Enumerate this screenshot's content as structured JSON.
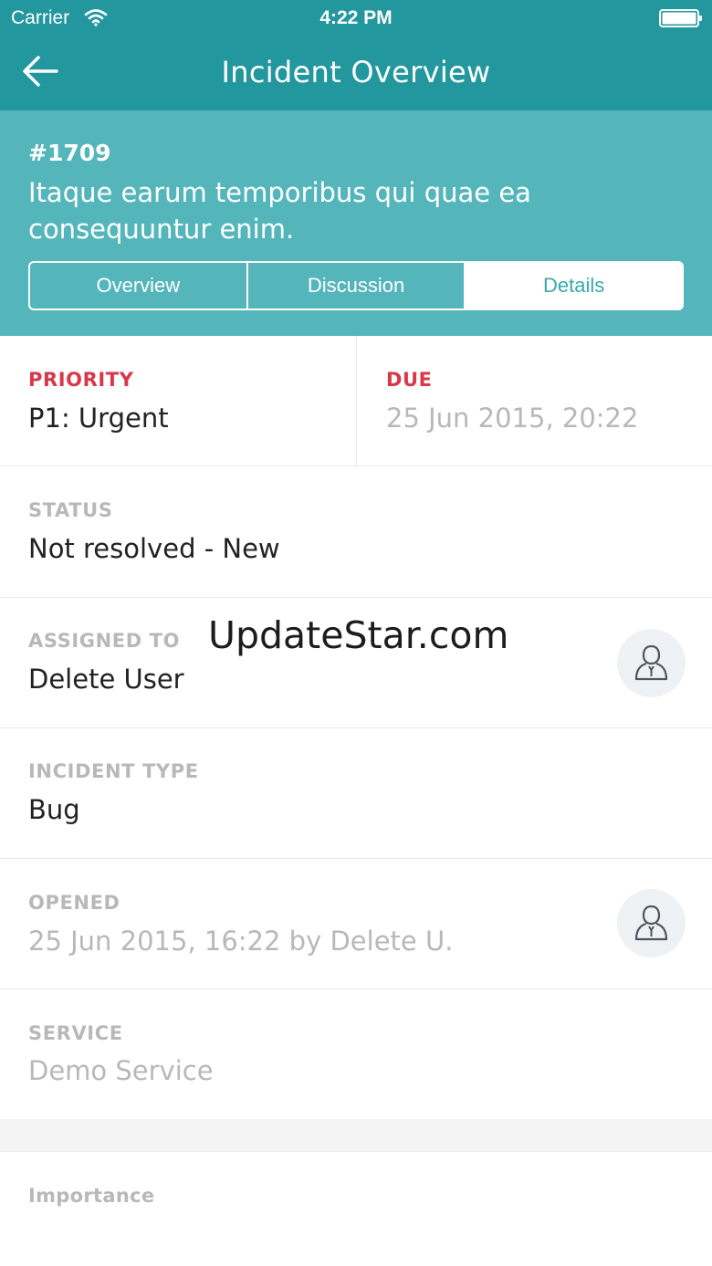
{
  "status_bar": {
    "carrier": "Carrier",
    "time": "4:22 PM"
  },
  "nav": {
    "title": "Incident Overview",
    "back_icon": "arrow-left-icon"
  },
  "incident": {
    "number": "#1709",
    "summary": "Itaque earum temporibus qui quae ea consequuntur enim."
  },
  "tabs": [
    {
      "label": "Overview",
      "active": false
    },
    {
      "label": "Discussion",
      "active": false
    },
    {
      "label": "Details",
      "active": true
    }
  ],
  "fields": {
    "priority": {
      "label": "PRIORITY",
      "value": "P1: Urgent"
    },
    "due": {
      "label": "DUE",
      "value": "25 Jun 2015, 20:22"
    },
    "status": {
      "label": "STATUS",
      "value": "Not resolved - New"
    },
    "assigned_to": {
      "label": "ASSIGNED TO",
      "value": "Delete User",
      "icon": "user-icon"
    },
    "incident_type": {
      "label": "INCIDENT TYPE",
      "value": "Bug"
    },
    "opened": {
      "label": "OPENED",
      "value": "25 Jun 2015, 16:22 by Delete U.",
      "icon": "user-icon"
    },
    "service": {
      "label": "SERVICE",
      "value": "Demo Service"
    },
    "importance": {
      "label": "Importance"
    }
  },
  "watermark": "UpdateStar.com",
  "colors": {
    "nav_bg": "#23979e",
    "header_bg": "#54b6bb",
    "label_accent": "#d9384b",
    "label_muted": "#b8b8b8"
  }
}
